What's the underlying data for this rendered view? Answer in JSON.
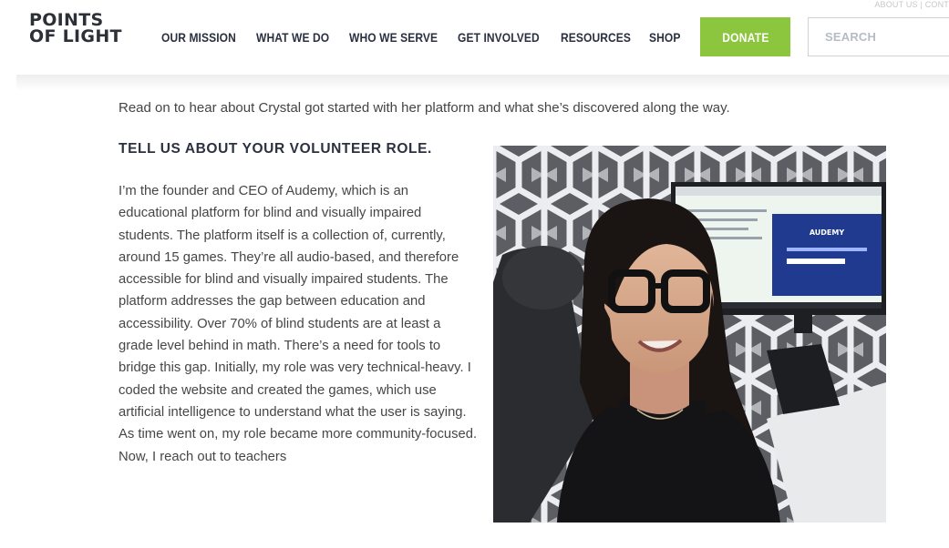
{
  "header": {
    "logo_line1": "POINTS",
    "logo_line2": "OF LIGHT",
    "topright": "ABOUT US | CONT",
    "nav": [
      "OUR MISSION",
      "WHAT WE DO",
      "WHO WE SERVE",
      "GET INVOLVED",
      "RESOURCES",
      "SHOP"
    ],
    "donate_label": "DONATE",
    "search_placeholder": "SEARCH"
  },
  "article": {
    "intro": "Read on to hear about Crystal got started with her platform and what she’s discovered along the way.",
    "heading": "TELL US ABOUT YOUR VOLUNTEER ROLE.",
    "body": "I’m the founder and CEO of Audemy, which is an educational platform for blind and visually impaired students. The platform itself is a collection of, currently, around 15 games. They’re all audio-based, and therefore accessible for blind and visually impaired students. The platform addresses the gap between education and accessibility. Over 70% of blind students are at least a grade level behind in math. There’s a need for tools to bridge this gap. Initially, my role was very technical-heavy. I coded the website and created the games, which use artificial intelligence to understand what the user is saying. As time went on, my role became more community-focused. Now, I reach out to teachers",
    "photo_screen_text": "AUDEMY"
  },
  "colors": {
    "accent": "#8cc63f",
    "navy": "#2b3140"
  }
}
